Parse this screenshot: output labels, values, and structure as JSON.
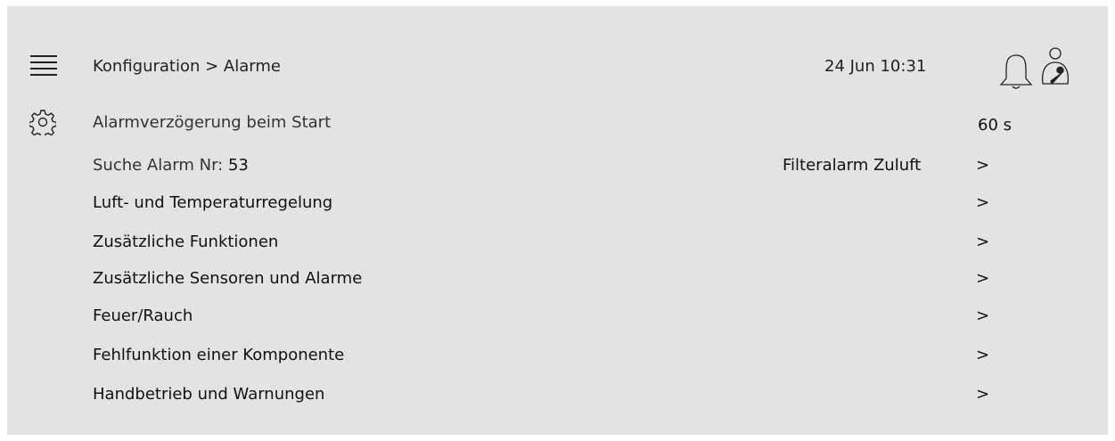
{
  "header": {
    "breadcrumb": "Konfiguration > Alarme",
    "datetime": "24 Jun 10:31",
    "icons": [
      "menu-icon",
      "bell-icon",
      "user-wrench-icon",
      "gear-icon"
    ]
  },
  "settings": {
    "startup_delay_label": "Alarmverzögerung beim Start",
    "startup_delay_value": "60 s",
    "search_label": "Suche Alarm Nr:",
    "search_number": "53",
    "search_result": "Filteralarm Zuluft",
    "search_chevron": ">"
  },
  "categories": [
    {
      "label": "Luft- und Temperaturregelung",
      "chevron": ">"
    },
    {
      "label": "Zusätzliche Funktionen",
      "chevron": ">"
    },
    {
      "label": "Zusätzliche Sensoren und Alarme",
      "chevron": ">"
    },
    {
      "label": "Feuer/Rauch",
      "chevron": ">"
    },
    {
      "label": "Fehlfunktion einer Komponente",
      "chevron": ">"
    },
    {
      "label": "Handbetrieb und Warnungen",
      "chevron": ">"
    }
  ],
  "colors": {
    "background": "#e3e3e3",
    "text": "#1a1a1a"
  }
}
